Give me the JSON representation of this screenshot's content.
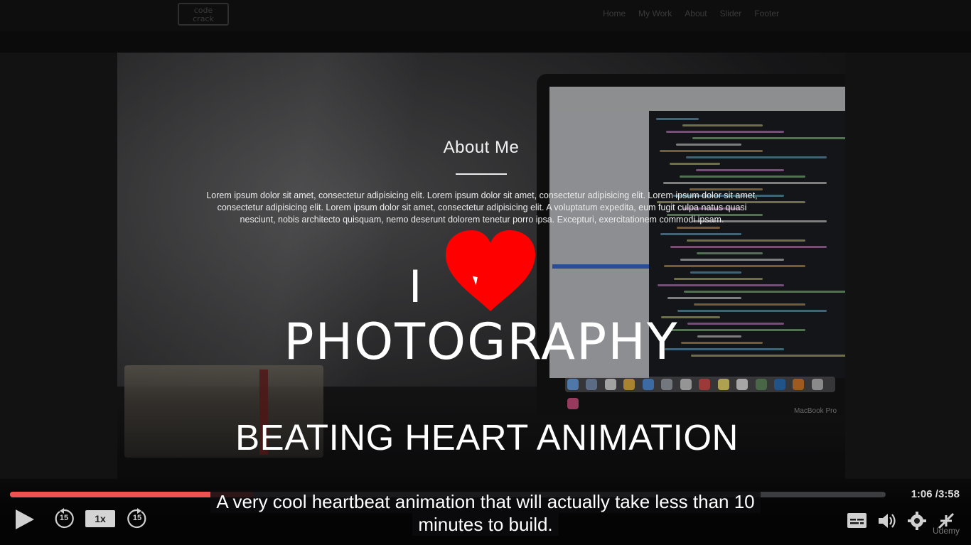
{
  "site": {
    "logo_top": "code",
    "logo_bottom": "crack",
    "nav": [
      "Home",
      "My Work",
      "About",
      "Slider",
      "Footer"
    ]
  },
  "video": {
    "about_title": "About Me",
    "about_text": "Lorem ipsum dolor sit amet, consectetur adipisicing elit. Lorem ipsum dolor sit amet, consectetur adipisicing elit. Lorem ipsum dolor sit amet, consectetur adipisicing elit. Lorem ipsum dolor sit amet, consectetur adipisicing elit. A voluptatum expedita, eum fugit culpa natus quasi nesciunt, nobis architecto quisquam, nemo deserunt dolorem tenetur porro ipsa. Excepturi, exercitationem commodi ipsam.",
    "i_letter": "I",
    "photography": "PHOTOGRAPHY",
    "headline": "BEATING HEART ANIMATION",
    "laptop_label": "MacBook Pro"
  },
  "player": {
    "progress_fraction": 0.278,
    "buffered_fraction": 0.74,
    "current_time": "1:06",
    "duration": "/3:58",
    "skip_back_label": "15",
    "skip_forward_label": "15",
    "speed_label": "1x",
    "caption_line1": "A very cool heartbeat animation that will actually take less than 10",
    "caption_line2": "minutes to build.",
    "watermark": "Udemy",
    "colors": {
      "progress": "#ec5252",
      "heart": "#ff0000"
    }
  }
}
